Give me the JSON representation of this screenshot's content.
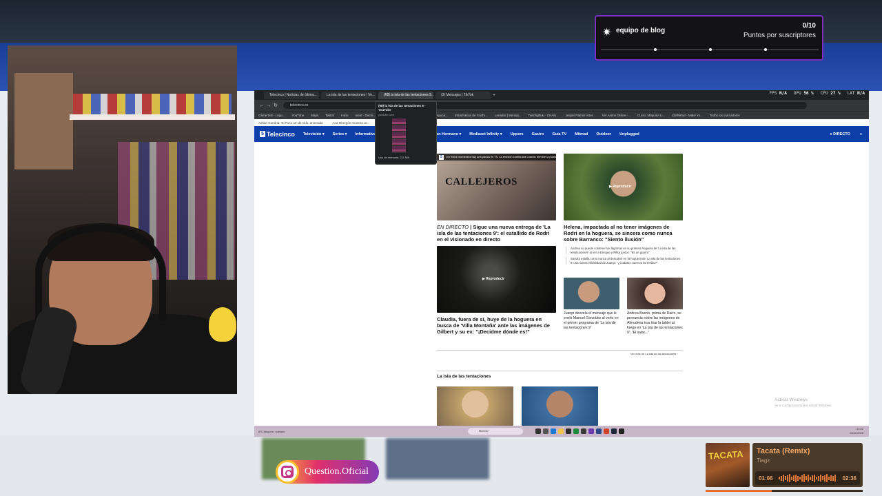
{
  "browser": {
    "tabs": [
      "Telecinco | Noticias de última...",
      "La isla de las tentaciones | Ve...",
      "(68) la isla de las tentaciones 9...",
      "(3) Mensajes | TikTok"
    ],
    "url": "telecinco.es",
    "bookmarks": [
      "Gamertiv8 - Lego...",
      "YouTube",
      "Maps",
      "Twitch",
      "Inicio",
      "ment - Decre...",
      "Professional Apoca...",
      "Professional Apoca...",
      "Estadísticas de YouTu...",
      "Lenador | Mensaj...",
      "Twitchgtfoki - CHAN...",
      "Jesper Ramos Arter...",
      "Ver Anime Online -...",
      "Curso: Máquina Li...",
      "@Shikhat - Make Yo...",
      "Todos los marcadores"
    ],
    "info_items": [
      "Adrián Gondria: 'Si Poco os' de Aldo, amenada",
      "Ana Obregón muestra un..."
    ],
    "sysstats": {
      "fps_label": "FPS",
      "fps": "N/A",
      "gpu_label": "GPU",
      "gpu": "56 %",
      "cpu_label": "CPU",
      "cpu": "27 %",
      "lat_label": "LAT",
      "lat": "N/A"
    }
  },
  "hover_card": {
    "title": "(68) la isla de las tentaciones 9 - YouTube",
    "url": "youtube.com",
    "memory": "Uso de memoria: 211 MB"
  },
  "site": {
    "logo": "Telecinco",
    "logo_num": "5",
    "nav": [
      "Televisión ▾",
      "Series ▾",
      "Informativos ▾",
      "Gran Hermano ▾",
      "Mediaset Infinity ▾",
      "Uppers",
      "Gastro",
      "Guía TV",
      "Mitmad",
      "Outdoor",
      "Unplugged"
    ],
    "directo": "● DIRECTO",
    "menu": "≡"
  },
  "articles": {
    "callejeros_ticker": "En estos momentos hay una pausa en TV. La emisión continuará cuando termine la publicidad",
    "callejeros_logo": "CALLEJEROS",
    "main_prefix": "EN DIRECTO",
    "main_headline": "Sigue una nueva entrega de 'La isla de las tentaciones 9': el estallido de Rodri en el visionado en directo",
    "helena_play": "Reproducir",
    "helena_headline": "Helena, impactada al no tener imágenes de Rodri en la hoguera, se sincera como nunca sobre Barranco: \"Siento ilusión\"",
    "bullets": [
      "Andrea no puede contener las lágrimas en su primera hoguera de 'La isla de las tentaciones 9' al ver a Enrique y Rifka juntos: \"Es un guarro\"",
      "Sandra estalla como nunca al descubrir en la hoguera de 'La isla de las tentaciones 9' una nueva infidelidad de Juanpi: \"¿Cuántos cuernos he tenido?\""
    ],
    "night_play": "Reproducir",
    "claudia_headline": "Claudia, fuera de sí, huye de la hoguera en busca de 'Villa Montaña' ante las imágenes de Gilbert y su ex: \"¡Decidme dónde es!\"",
    "juanpi_headline": "Juanpi desvela el mensaje que le envió Manuel González al verlo en el primer programa de 'La isla de las tentaciones 9'",
    "andrea_headline": "Andrea Bueno, prima de Darío, se pronuncia sobre las imágenes de Almudena tras tirar la tablet al fuego en 'La isla de las tentaciones 9': \"El sabe...\"",
    "more_link": "Ver más de La isla de las tentaciones ›",
    "section_title": "La isla de las tentaciones"
  },
  "windows_watermark": {
    "line1": "Activar Windows",
    "line2": "Ve a Configuración para activar Windows."
  },
  "taskbar": {
    "weather": "8ºC Mayorm. nublado",
    "search": "Buscar",
    "time": "22:02",
    "date": "26/11/2025"
  },
  "alert": {
    "name": "equipo de blog",
    "count": "0/10",
    "subtitle": "Puntos por suscriptores",
    "progress": 0
  },
  "instagram": {
    "handle": "Question.Oficial"
  },
  "music": {
    "album_text": "TACATA",
    "song": "Tacata (Remix)",
    "artist": "Tiagz",
    "elapsed": "01:06",
    "duration": "02:36",
    "progress": 0.42
  },
  "colors": {
    "accent_purple": "#7b2fb8",
    "telecinco_blue": "#0e3ea8",
    "music_orange": "#f3a868"
  }
}
